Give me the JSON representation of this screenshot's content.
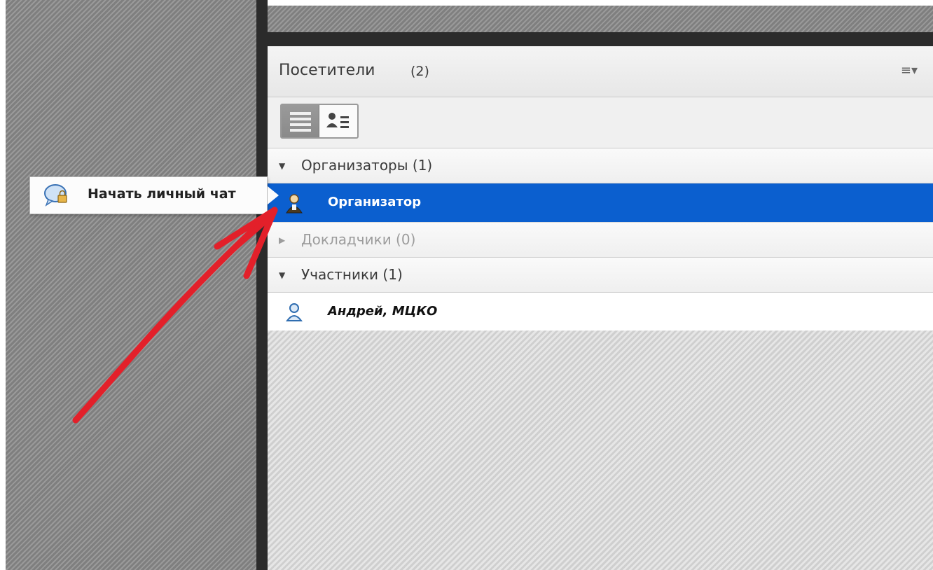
{
  "attendees_panel": {
    "title": "Посетители",
    "count": "(2)",
    "menu_icon": "menu-dropdown-icon",
    "toolbar": {
      "list_view_icon": "list-view-icon",
      "detail_view_icon": "attendee-list-icon"
    },
    "sections": [
      {
        "label": "Организаторы (1)",
        "expanded": true
      },
      {
        "label": "Докладчики (0)",
        "expanded": false
      },
      {
        "label": "Участники (1)",
        "expanded": true
      }
    ],
    "rows": [
      {
        "label": "Организатор",
        "icon": "host-user-icon",
        "selected": true
      },
      {
        "label": "Андрей, МЦКО",
        "icon": "participant-user-icon",
        "selected": false
      }
    ]
  },
  "context_tooltip": {
    "label": "Начать личный чат",
    "icon": "private-chat-icon"
  },
  "colors": {
    "selection": "#0b5fcf",
    "annotation_arrow": "#e3202a",
    "divider": "#2b2b2b"
  }
}
